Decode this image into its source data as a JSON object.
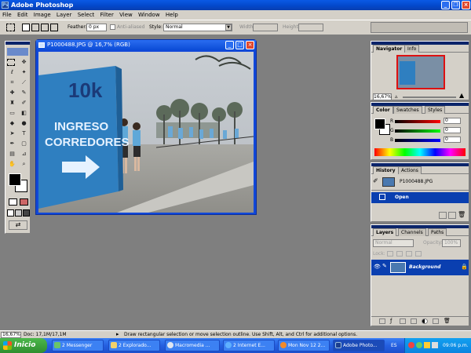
{
  "app": {
    "title": "Adobe Photoshop"
  },
  "menu": [
    "File",
    "Edit",
    "Image",
    "Layer",
    "Select",
    "Filter",
    "View",
    "Window",
    "Help"
  ],
  "options": {
    "feather_label": "Feather:",
    "feather_value": "0 px",
    "antialiased_label": "Anti-aliased",
    "style_label": "Style:",
    "style_value": "Normal",
    "width_label": "Width:",
    "height_label": "Height:"
  },
  "document": {
    "title": "P1000488.JPG @ 16,7% (RGB)",
    "sign_brand": "10k",
    "sign_line1": "INGRESO",
    "sign_line2": "CORREDORES"
  },
  "navigator": {
    "tab_navigator": "Navigator",
    "tab_info": "Info",
    "zoom": "16,67%"
  },
  "color_panel": {
    "tab_color": "Color",
    "tab_swatches": "Swatches",
    "tab_styles": "Styles",
    "r_label": "R",
    "g_label": "G",
    "b_label": "B",
    "r_value": "0",
    "g_value": "0",
    "b_value": "0"
  },
  "history": {
    "tab_history": "History",
    "tab_actions": "Actions",
    "snapshot": "P1000488.JPG",
    "step": "Open"
  },
  "layers": {
    "tab_layers": "Layers",
    "tab_channels": "Channels",
    "tab_paths": "Paths",
    "blend_mode": "Normal",
    "opacity_label": "Opacity:",
    "opacity_value": "100%",
    "lock_label": "Lock:",
    "layer_name": "Background"
  },
  "statusbar": {
    "zoom": "16,67%",
    "doc_size": "Doc: 17,1M/17,1M",
    "hint": "Draw rectangular selection or move selection outline. Use Shift, Alt, and Ctrl for additional options."
  },
  "taskbar": {
    "start": "Inicio",
    "tasks": [
      "2 Messenger",
      "2 Explorado...",
      "Macromedia ...",
      "2 Internet E...",
      "Mon Nov 12 2...",
      "Adobe Photo..."
    ],
    "lang": "ES",
    "clock": "09:06 p.m."
  }
}
